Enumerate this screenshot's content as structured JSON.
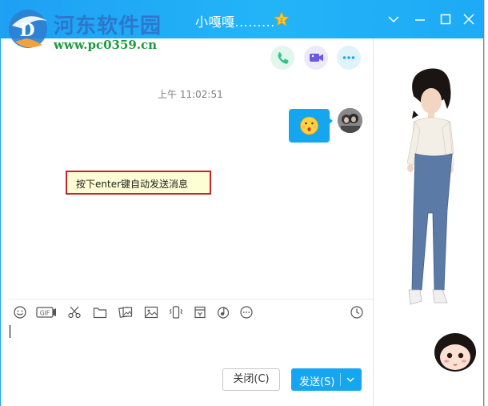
{
  "window": {
    "title": "小嘎嘎.........",
    "controls": [
      "chevron-down-icon",
      "minimize-icon",
      "maximize-icon",
      "close-icon"
    ]
  },
  "watermark": {
    "name": "河东软件园",
    "url": "www.pc0359.cn"
  },
  "header_actions": [
    {
      "name": "phone-call-icon",
      "color": "#34c48a"
    },
    {
      "name": "video-call-icon",
      "color": "#6b57e8"
    },
    {
      "name": "more-icon",
      "color": "#18a9f3"
    }
  ],
  "chat": {
    "timestamp": "上午 11:02:51",
    "messages": [
      {
        "from": "self",
        "type": "emoji",
        "content": "face-emoji"
      }
    ]
  },
  "hint": {
    "text": "按下enter键自动发送消息"
  },
  "toolbar": {
    "icons": [
      "emoji-icon",
      "gif-icon",
      "scissors-icon",
      "folder-icon",
      "image-folder-icon",
      "image-icon",
      "shake-icon",
      "calendar-icon",
      "music-icon",
      "more-dots-icon"
    ],
    "history_icon": "clock-icon"
  },
  "compose": {
    "value": ""
  },
  "buttons": {
    "close_label": "关闭(C)",
    "send_label": "发送(S)"
  },
  "colors": {
    "title_bar": "#1ea0f4",
    "send_button": "#16a6f0",
    "hint_border": "#c4242c",
    "hint_bg": "#fefed4"
  }
}
